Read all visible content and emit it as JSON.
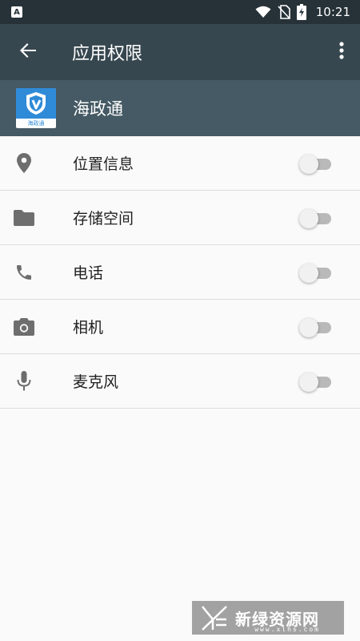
{
  "status_bar": {
    "notification_badge": "A",
    "time": "10:21"
  },
  "app_bar": {
    "title": "应用权限",
    "back_icon": "arrow-back-icon",
    "menu_icon": "more-vert-icon",
    "background": "#37474f"
  },
  "app_header": {
    "app_name": "海政通",
    "icon_label": "海政通",
    "background": "#455a64",
    "icon_color": "#2f8bd8"
  },
  "permissions": [
    {
      "label": "位置信息",
      "icon": "location-pin-icon",
      "enabled": false
    },
    {
      "label": "存储空间",
      "icon": "folder-icon",
      "enabled": false
    },
    {
      "label": "电话",
      "icon": "phone-icon",
      "enabled": false
    },
    {
      "label": "相机",
      "icon": "camera-icon",
      "enabled": false
    },
    {
      "label": "麦克风",
      "icon": "microphone-icon",
      "enabled": false
    }
  ],
  "watermark": {
    "text": "新绿资源网",
    "sub": "www.xlhs.com"
  }
}
